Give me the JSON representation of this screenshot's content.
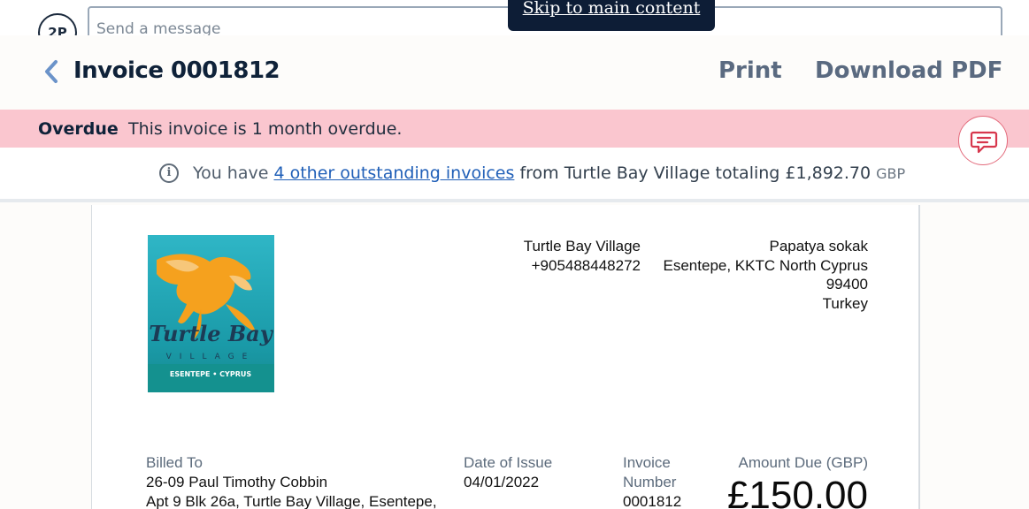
{
  "skip_link": "Skip to main content",
  "composer": {
    "avatar_initials": "2P",
    "placeholder": "Send a message"
  },
  "header": {
    "back_icon": "chevron-left-icon",
    "title": "Invoice 0001812",
    "print_label": "Print",
    "download_label": "Download PDF"
  },
  "overdue": {
    "label": "Overdue",
    "text": "This invoice is 1 month overdue."
  },
  "info": {
    "icon": "info-icon",
    "prefix": "You have",
    "link": "4 other outstanding invoices",
    "middle": "from Turtle Bay Village totaling £1,892.70",
    "currency": "GBP"
  },
  "chat_icon": "chat-bubble-icon",
  "invoice": {
    "logo": {
      "name": "Turtle Bay",
      "sub": "VILLAGE",
      "location": "ESENTEPE • CYPRUS"
    },
    "sender": {
      "name": "Turtle Bay Village",
      "phone": "+905488448272"
    },
    "address": {
      "line1": "Papatya sokak",
      "line2": "Esentepe, KKTC North Cyprus",
      "postcode": "99400",
      "country": "Turkey"
    },
    "billed_to": {
      "label": "Billed To",
      "name": "26-09 Paul Timothy Cobbin",
      "address": "Apt 9 Blk 26a, Turtle Bay Village, Esentepe,"
    },
    "date_of_issue": {
      "label": "Date of Issue",
      "value": "04/01/2022"
    },
    "invoice_number": {
      "label_line1": "Invoice",
      "label_line2": "Number",
      "value": "0001812"
    },
    "amount_due": {
      "label": "Amount Due (GBP)",
      "value": "£150.00"
    }
  },
  "colors": {
    "overdue_bg": "#fac6cf",
    "link": "#2160b8",
    "navy": "#0d1d36",
    "chat_accent": "#d7374d"
  }
}
